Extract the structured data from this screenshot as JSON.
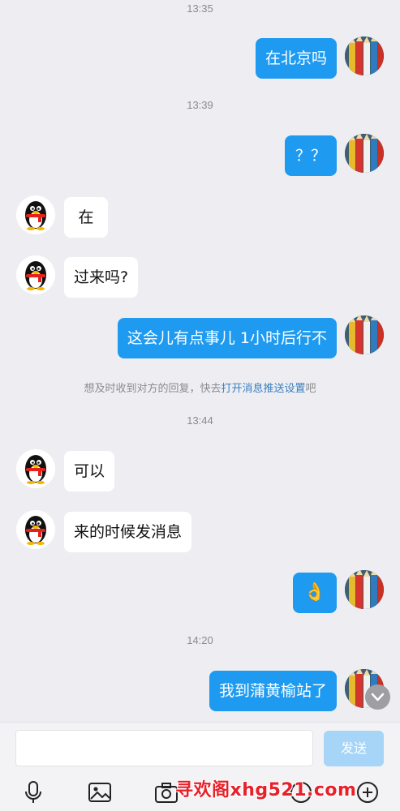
{
  "messages": {
    "t1": "13:35",
    "m1": "在北京吗",
    "t2": "13:39",
    "m2": "？？",
    "m3": "在",
    "m4": "过来吗?",
    "m5": "这会儿有点事儿 1小时后行不",
    "notice_prefix": "想及时收到对方的回复，快去",
    "notice_link": "打开消息推送设置",
    "notice_suffix": "吧",
    "t3": "13:44",
    "m6": "可以",
    "m7": "来的时候发消息",
    "m8_emoji": "👌",
    "t4": "14:20",
    "m9": "我到蒲黄榆站了"
  },
  "input": {
    "placeholder": "",
    "send_label": "发送"
  },
  "toolbar": {
    "icons": [
      "microphone-icon",
      "image-icon",
      "camera-icon",
      "emoji-icon",
      "plus-icon"
    ]
  },
  "watermark": "寻欢阁xhg521.com",
  "colors": {
    "outgoing_bubble": "#1e9bf0",
    "incoming_bubble": "#ffffff",
    "background": "#eeeef2",
    "send_button": "#a6d5f8"
  }
}
